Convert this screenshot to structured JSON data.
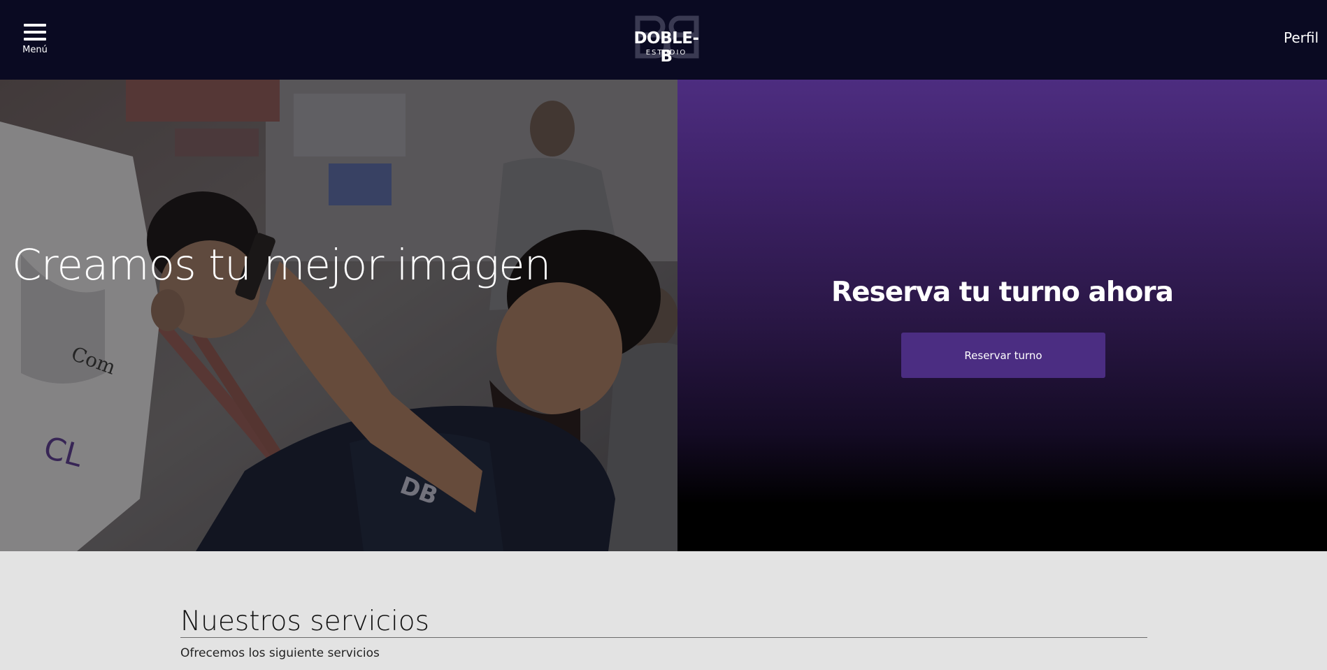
{
  "header": {
    "menu_label": "Menú",
    "logo_name": "DOBLE-B",
    "logo_sub": "ESTUDIO",
    "profile_label": "Perfil",
    "icons": {
      "menu": "hamburger-menu-icon"
    }
  },
  "hero": {
    "heading": "Creamos tu mejor imagen",
    "booking_title": "Reserva tu turno ahora",
    "booking_button": "Reservar turno"
  },
  "services": {
    "title": "Nuestros servicios",
    "subtitle": "Ofrecemos los siguiente servicios"
  },
  "colors": {
    "header_bg": "#0a0a22",
    "accent": "#4b2d82",
    "panel_top": "#4d2d80",
    "page_bg": "#e3e3e3"
  }
}
